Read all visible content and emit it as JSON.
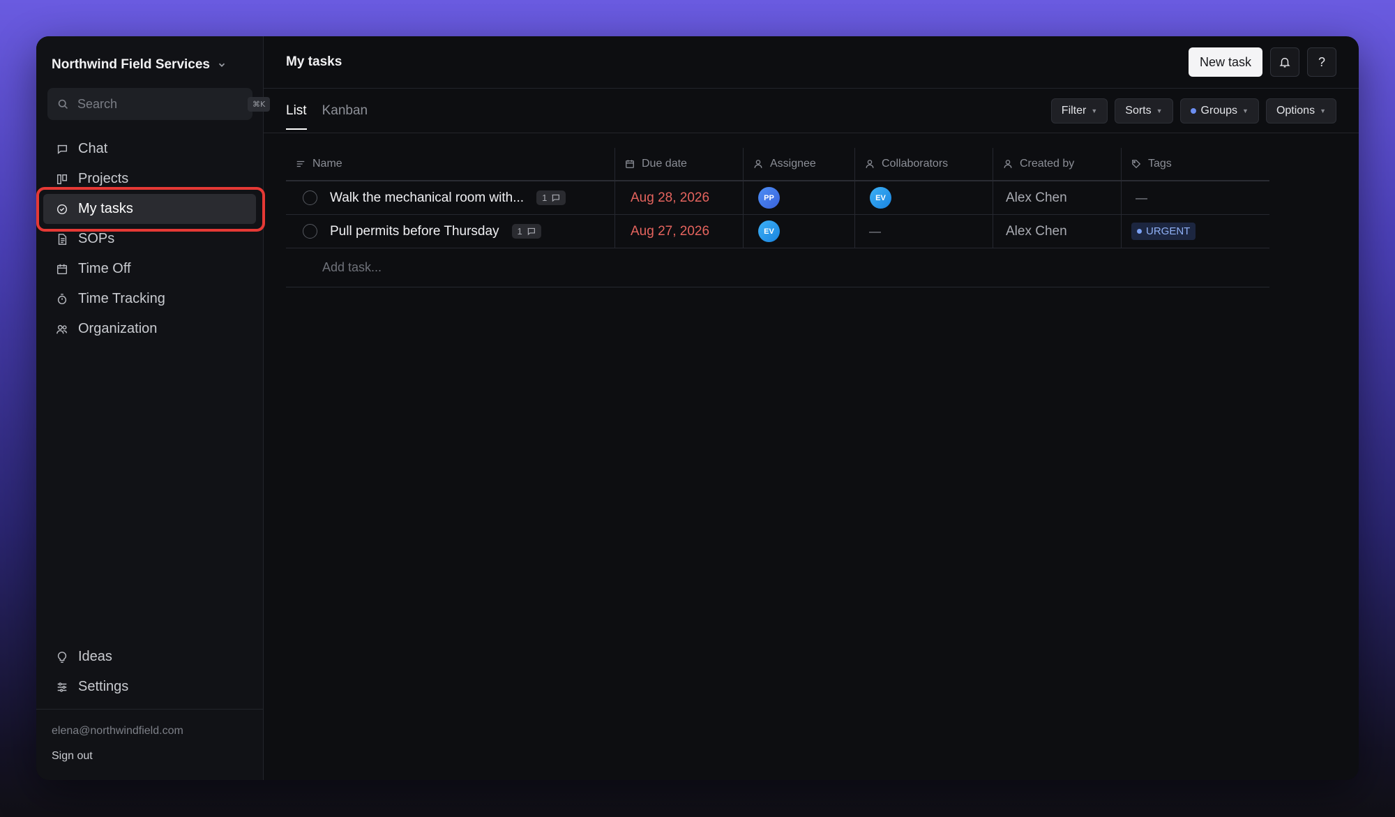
{
  "sidebar": {
    "workspace_name": "Northwind Field Services",
    "search_placeholder": "Search",
    "search_shortcut": "⌘K",
    "nav": [
      {
        "label": "Chat",
        "icon": "chat-icon"
      },
      {
        "label": "Projects",
        "icon": "projects-icon"
      },
      {
        "label": "My tasks",
        "icon": "check-circle-icon",
        "active": true
      },
      {
        "label": "SOPs",
        "icon": "document-icon"
      },
      {
        "label": "Time Off",
        "icon": "calendar-icon"
      },
      {
        "label": "Time Tracking",
        "icon": "stopwatch-icon"
      },
      {
        "label": "Organization",
        "icon": "people-icon"
      }
    ],
    "nav_bottom": [
      {
        "label": "Ideas",
        "icon": "lightbulb-icon"
      },
      {
        "label": "Settings",
        "icon": "sliders-icon"
      }
    ],
    "user_email": "elena@northwindfield.com",
    "sign_out": "Sign out"
  },
  "header": {
    "title": "My tasks",
    "new_task": "New task",
    "help": "?"
  },
  "views": {
    "tabs": [
      "List",
      "Kanban"
    ],
    "active_tab": "List",
    "filter": "Filter",
    "sorts": "Sorts",
    "groups": "Groups",
    "options": "Options"
  },
  "table": {
    "columns": [
      "Name",
      "Due date",
      "Assignee",
      "Collaborators",
      "Created by",
      "Tags"
    ],
    "rows": [
      {
        "name": "Walk the mechanical room with...",
        "comments": "1",
        "due": "Aug 28, 2026",
        "assignee": "PP",
        "collaborator": "EV",
        "created_by": "Alex Chen",
        "tag": "—"
      },
      {
        "name": "Pull permits before Thursday",
        "comments": "1",
        "due": "Aug 27, 2026",
        "assignee": "EV",
        "collaborator": "—",
        "created_by": "Alex Chen",
        "tag": "URGENT"
      }
    ],
    "add_task": "Add task..."
  },
  "colors": {
    "accent_red_highlight": "#e53935",
    "due_overdue": "#e5645e",
    "tag_urgent": "#8fb0f5"
  }
}
